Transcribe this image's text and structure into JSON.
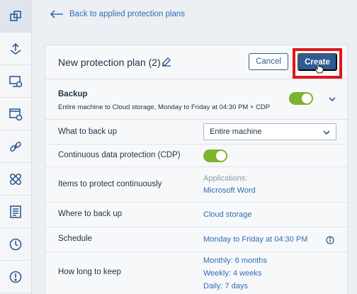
{
  "sidebar": {
    "items": [
      {
        "icon": "copy-icon",
        "active": true
      },
      {
        "icon": "backup-upload-icon"
      },
      {
        "icon": "monitor-sync-icon"
      },
      {
        "icon": "window-sync-icon"
      },
      {
        "icon": "link-icon"
      },
      {
        "icon": "bandage-icon"
      },
      {
        "icon": "report-icon"
      },
      {
        "icon": "clock-icon"
      },
      {
        "icon": "alert-icon"
      }
    ]
  },
  "back_link": {
    "label": "Back to applied protection plans"
  },
  "header": {
    "plan_title": "New protection plan (2)",
    "cancel_label": "Cancel",
    "create_label": "Create"
  },
  "backup": {
    "title": "Backup",
    "summary": "Entire machine to Cloud storage, Monday to Friday at 04:30 PM + CDP",
    "enabled": true
  },
  "rows": {
    "what": {
      "label": "What to back up",
      "value": "Entire machine"
    },
    "cdp": {
      "label": "Continuous data protection (CDP)",
      "enabled": true
    },
    "items": {
      "label": "Items to protect continuously",
      "caption": "Applications:",
      "value": "Microsoft Word"
    },
    "where": {
      "label": "Where to back up",
      "value": "Cloud storage"
    },
    "schedule": {
      "label": "Schedule",
      "value": "Monday to Friday at 04:30 PM"
    },
    "keep": {
      "label": "How long to keep",
      "monthly": "Monthly: 6 months",
      "weekly": "Weekly: 4 weeks",
      "daily": "Daily: 7 days"
    }
  },
  "colors": {
    "accent": "#2f5b93",
    "link": "#2f6db5",
    "toggle_on": "#7cb32f",
    "highlight": "#e0161c"
  }
}
